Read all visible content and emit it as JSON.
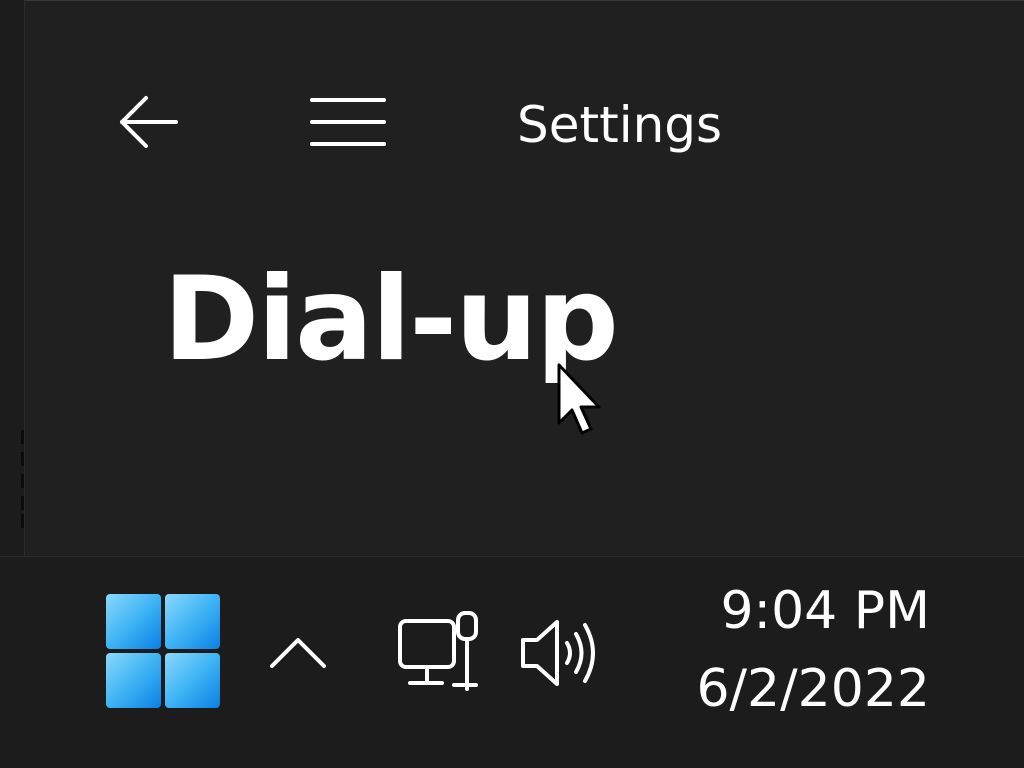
{
  "window": {
    "app_title": "Settings",
    "page_title": "Dial-up"
  },
  "nav": {
    "back_icon": "back-arrow-icon",
    "menu_icon": "hamburger-menu-icon"
  },
  "taskbar": {
    "start_icon": "windows-logo-icon",
    "overflow_icon": "chevron-up-icon",
    "network_icon": "wired-network-icon",
    "volume_icon": "speaker-volume-icon",
    "clock": {
      "time": "9:04 PM",
      "date": "6/2/2022"
    }
  },
  "colors": {
    "background": "#202020",
    "taskbar": "#1c1c1c",
    "text": "#ffffff",
    "start_accent_light": "#7fd3fa",
    "start_accent_dark": "#0a84e6"
  }
}
